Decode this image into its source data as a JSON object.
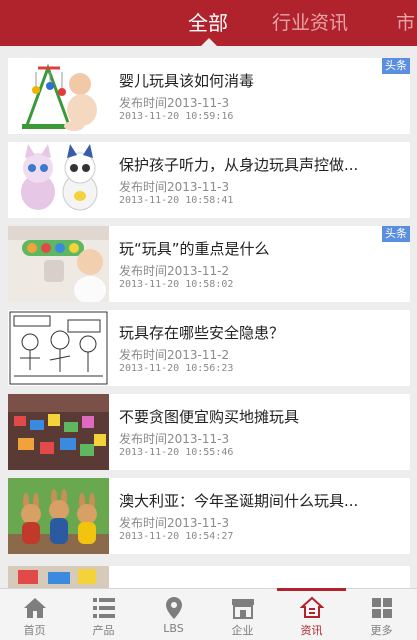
{
  "header": {
    "tabs": [
      {
        "label": "全部",
        "active": true
      },
      {
        "label": "行业资讯",
        "active": false
      },
      {
        "label": "市",
        "active": false
      }
    ]
  },
  "news": [
    {
      "title": "婴儿玩具该如何消毒",
      "published": "发布时间2013-11-3",
      "timestamp": "2013-11-20 10:59:16",
      "badge": "头条",
      "thumb": "baby-gym-toy"
    },
    {
      "title": "保护孩子听力，从身边玩具声控做...",
      "published": "发布时间2013-11-3",
      "timestamp": "2013-11-20 10:58:41",
      "badge": "",
      "thumb": "robot-cats"
    },
    {
      "title": "玩“玩具”的重点是什么",
      "published": "发布时间2013-11-2",
      "timestamp": "2013-11-20 10:58:02",
      "badge": "头条",
      "thumb": "baby-with-rattle"
    },
    {
      "title": "玩具存在哪些安全隐患？",
      "published": "发布时间2013-11-2",
      "timestamp": "2013-11-20 10:56:23",
      "badge": "",
      "thumb": "cartoon-sketch"
    },
    {
      "title": "不要贪图便宜购买地摊玩具",
      "published": "发布时间2013-11-3",
      "timestamp": "2013-11-20 10:55:46",
      "badge": "",
      "thumb": "toy-stall"
    },
    {
      "title": "澳大利亚：今年圣诞期间什么玩具...",
      "published": "发布时间2013-11-3",
      "timestamp": "2013-11-20 10:54:27",
      "badge": "",
      "thumb": "toy-kangaroos"
    }
  ],
  "bottom_nav": [
    {
      "label": "首页",
      "icon": "home-icon",
      "active": false
    },
    {
      "label": "产品",
      "icon": "list-icon",
      "active": false
    },
    {
      "label": "LBS",
      "icon": "location-pin-icon",
      "active": false
    },
    {
      "label": "企业",
      "icon": "store-icon",
      "active": false
    },
    {
      "label": "资讯",
      "icon": "news-icon",
      "active": true
    },
    {
      "label": "更多",
      "icon": "grid-icon",
      "active": false
    }
  ],
  "colors": {
    "brand": "#b0232c",
    "badge": "#5a8fe0",
    "inactive_tab": "#e7a3a7"
  }
}
